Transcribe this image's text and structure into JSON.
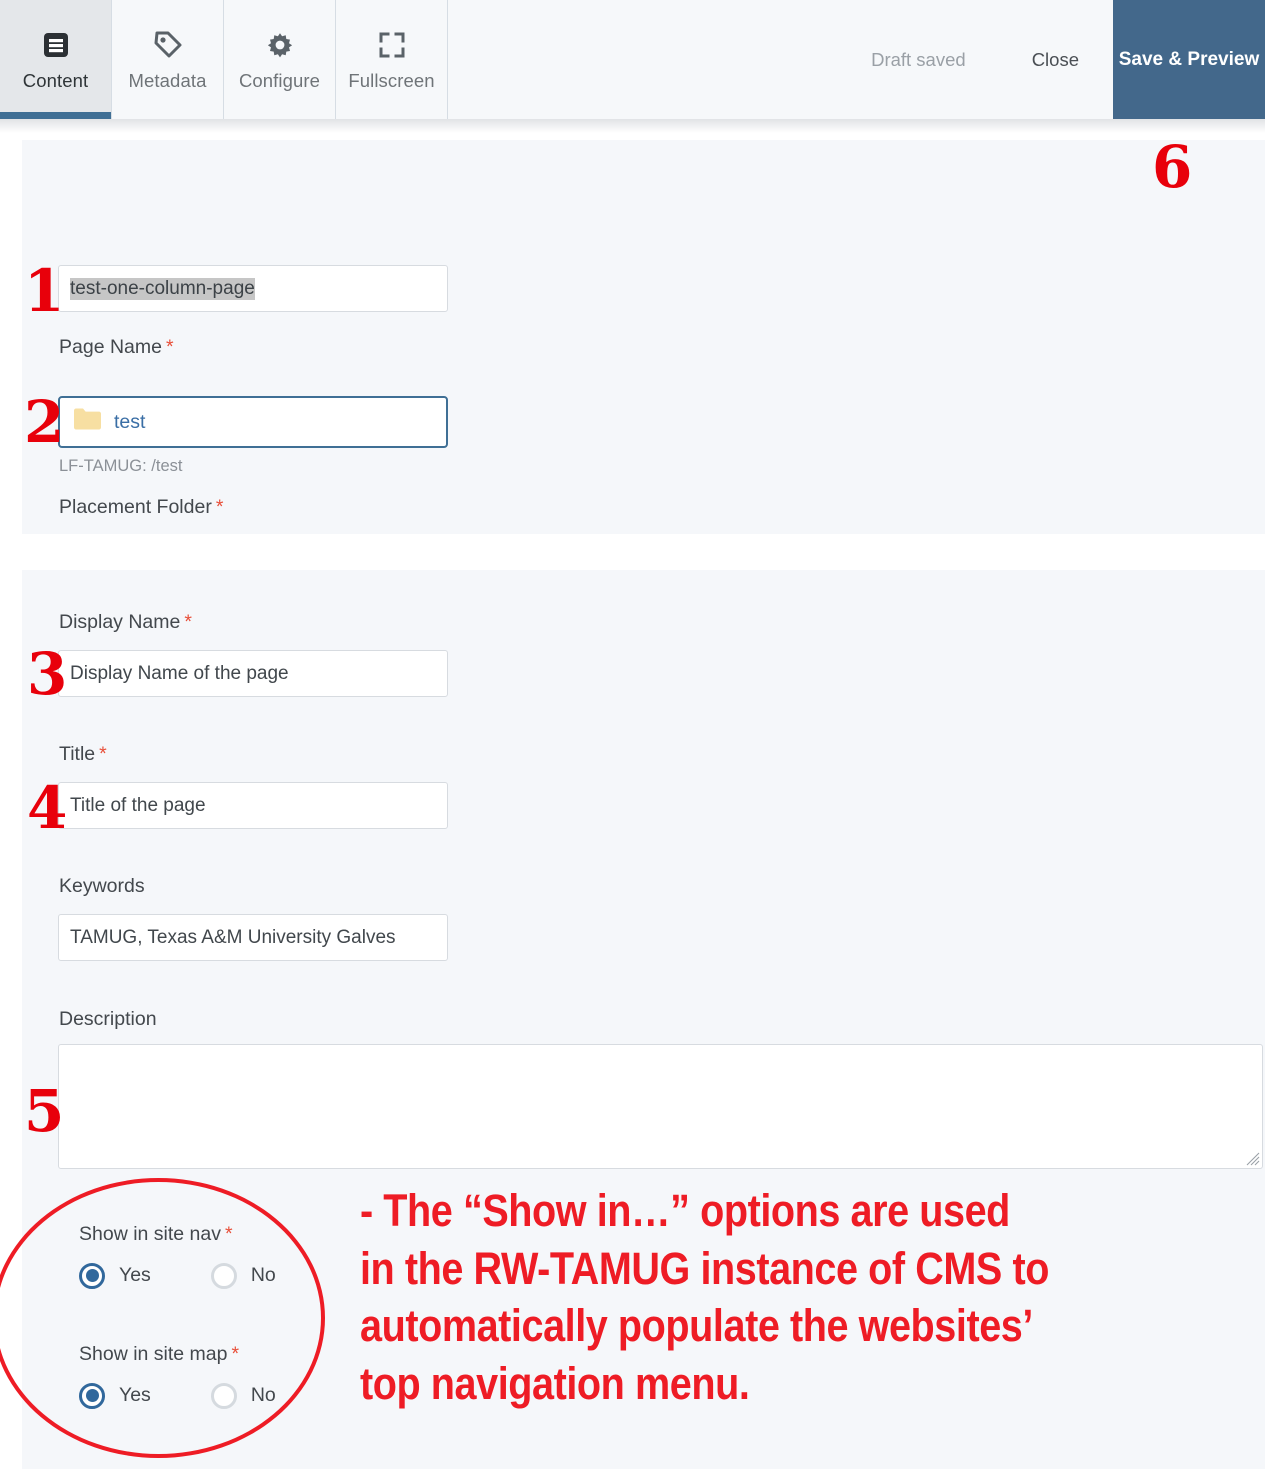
{
  "toolbar": {
    "tabs": [
      {
        "label": "Content",
        "icon": "content-lines-icon",
        "active": true
      },
      {
        "label": "Metadata",
        "icon": "tag-icon",
        "active": false
      },
      {
        "label": "Configure",
        "icon": "gear-icon",
        "active": false
      },
      {
        "label": "Fullscreen",
        "icon": "fullscreen-icon",
        "active": false
      }
    ],
    "draft_status": "Draft saved",
    "close_label": "Close",
    "save_preview_label": "Save &\nPreview",
    "accent_color": "#43688b",
    "active_tab_underline_color": "#3f6f95"
  },
  "form": {
    "page_name": {
      "label": "Page Name",
      "required": true,
      "value": "test-one-column-page",
      "selected": true
    },
    "placement_folder": {
      "label": "Placement Folder",
      "required": true,
      "value": "test",
      "icon": "folder-icon",
      "folder_color": "#f6dfa0",
      "link_color": "#3a6ea5",
      "focused": true,
      "hint": "LF-TAMUG: /test"
    },
    "display_name": {
      "label": "Display Name",
      "required": true,
      "value": "Display Name of the page"
    },
    "title": {
      "label": "Title",
      "required": true,
      "value": "Title of the page"
    },
    "keywords": {
      "label": "Keywords",
      "required": false,
      "value": "TAMUG, Texas A&M University Galves"
    },
    "description": {
      "label": "Description",
      "required": false,
      "value": ""
    },
    "show_in_site_nav": {
      "label": "Show in site nav",
      "required": true,
      "options": [
        "Yes",
        "No"
      ],
      "selected": "Yes"
    },
    "show_in_site_map": {
      "label": "Show in site map",
      "required": true,
      "options": [
        "Yes",
        "No"
      ],
      "selected": "Yes"
    }
  },
  "annotations": {
    "numbers": [
      "1",
      "2",
      "3",
      "4",
      "5",
      "6"
    ],
    "color": "#e8000b",
    "callout_text": "- The “Show in…”  options are used\nin the RW-TAMUG instance of CMS to\nautomatically populate the websites’\ntop navigation menu.",
    "ellipse_color": "#ee1c25"
  }
}
